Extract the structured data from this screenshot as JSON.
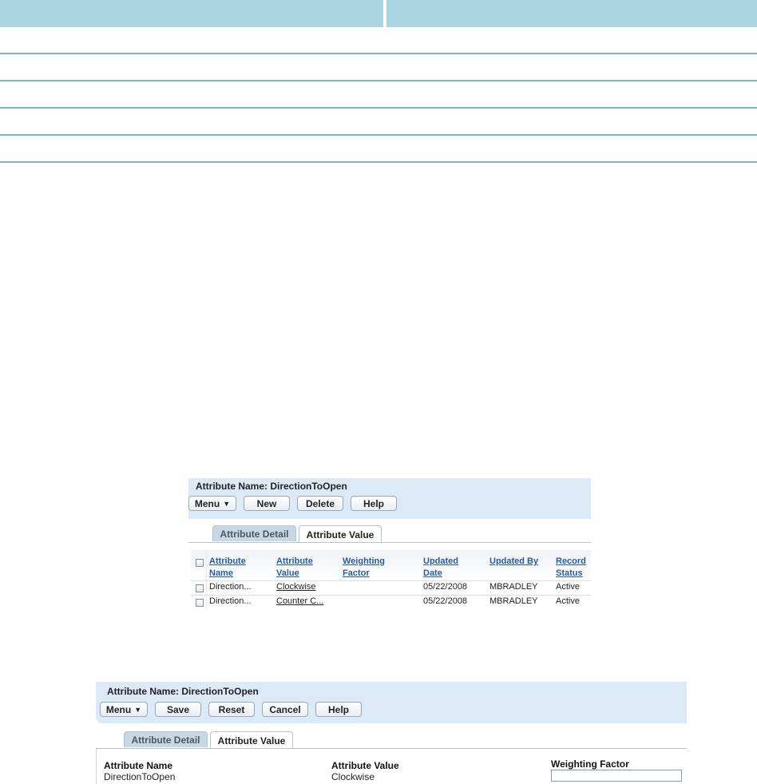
{
  "top_table": {
    "row_count": 5
  },
  "panel1": {
    "title": "Attribute Name: DirectionToOpen",
    "buttons": {
      "menu": "Menu",
      "new": "New",
      "delete": "Delete",
      "help": "Help"
    },
    "menu_arrow": "▼",
    "tabs": {
      "detail": "Attribute Detail",
      "value": "Attribute Value"
    },
    "columns": {
      "attribute_name": [
        "Attribute",
        "Name"
      ],
      "attribute_value": [
        "Attribute",
        "Value"
      ],
      "weighting_factor": [
        "Weighting",
        "Factor"
      ],
      "updated_date": [
        "Updated",
        "Date"
      ],
      "updated_by": [
        "Updated By"
      ],
      "record_status": [
        "Record",
        "Status"
      ]
    },
    "rows": [
      {
        "attribute_name": "Direction...",
        "attribute_value": "Clockwise",
        "weighting_factor": "",
        "updated_date": "05/22/2008",
        "updated_by": "MBRADLEY",
        "record_status": "Active"
      },
      {
        "attribute_name": "Direction...",
        "attribute_value": "Counter C...",
        "weighting_factor": "",
        "updated_date": "05/22/2008",
        "updated_by": "MBRADLEY",
        "record_status": "Active"
      }
    ]
  },
  "panel2": {
    "title": "Attribute Name: DirectionToOpen",
    "buttons": {
      "menu": "Menu",
      "save": "Save",
      "reset": "Reset",
      "cancel": "Cancel",
      "help": "Help"
    },
    "menu_arrow": "▼",
    "tabs": {
      "detail": "Attribute Detail",
      "value": "Attribute Value"
    },
    "fields": {
      "attribute_name": {
        "label": "Attribute Name",
        "value": "DirectionToOpen"
      },
      "attribute_value": {
        "label": "Attribute Value",
        "value": "Clockwise"
      },
      "weighting_factor": {
        "label": "Weighting Factor",
        "value": ""
      }
    }
  },
  "colors": {
    "table_header": "#a9d4e2",
    "panel_header": "#dce9f6",
    "link": "#2a5aa0"
  }
}
